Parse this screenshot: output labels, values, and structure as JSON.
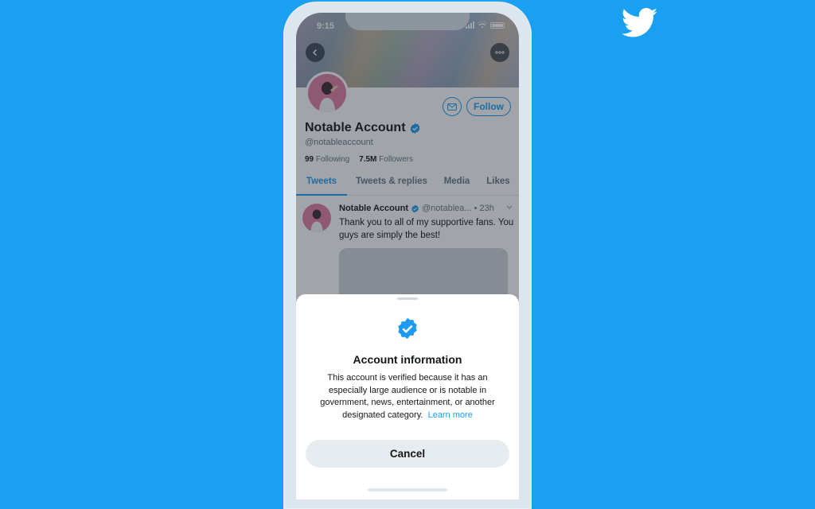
{
  "brand": {
    "logo_icon": "twitter-bird-icon"
  },
  "status_bar": {
    "time": "9:15"
  },
  "profile": {
    "name": "Notable Account",
    "handle": "@notableaccount",
    "following_count": "99",
    "following_label": "Following",
    "followers_count": "7.5M",
    "followers_label": "Followers",
    "follow_label": "Follow",
    "verified": true
  },
  "tabs": [
    {
      "label": "Tweets",
      "active": true
    },
    {
      "label": "Tweets & replies",
      "active": false
    },
    {
      "label": "Media",
      "active": false
    },
    {
      "label": "Likes",
      "active": false
    }
  ],
  "tweet": {
    "author": "Notable Account",
    "meta": "@notablea... • 23h",
    "text": "Thank you to all of my supportive fans. You guys are simply the best!"
  },
  "sheet": {
    "title": "Account information",
    "body": "This account is verified because it has an especially large audience or is notable in government, news, entertainment, or another designated category.",
    "learn_more": "Learn more",
    "cancel_label": "Cancel"
  },
  "colors": {
    "background": "#1aa0f0",
    "accent": "#1d9bf0"
  }
}
